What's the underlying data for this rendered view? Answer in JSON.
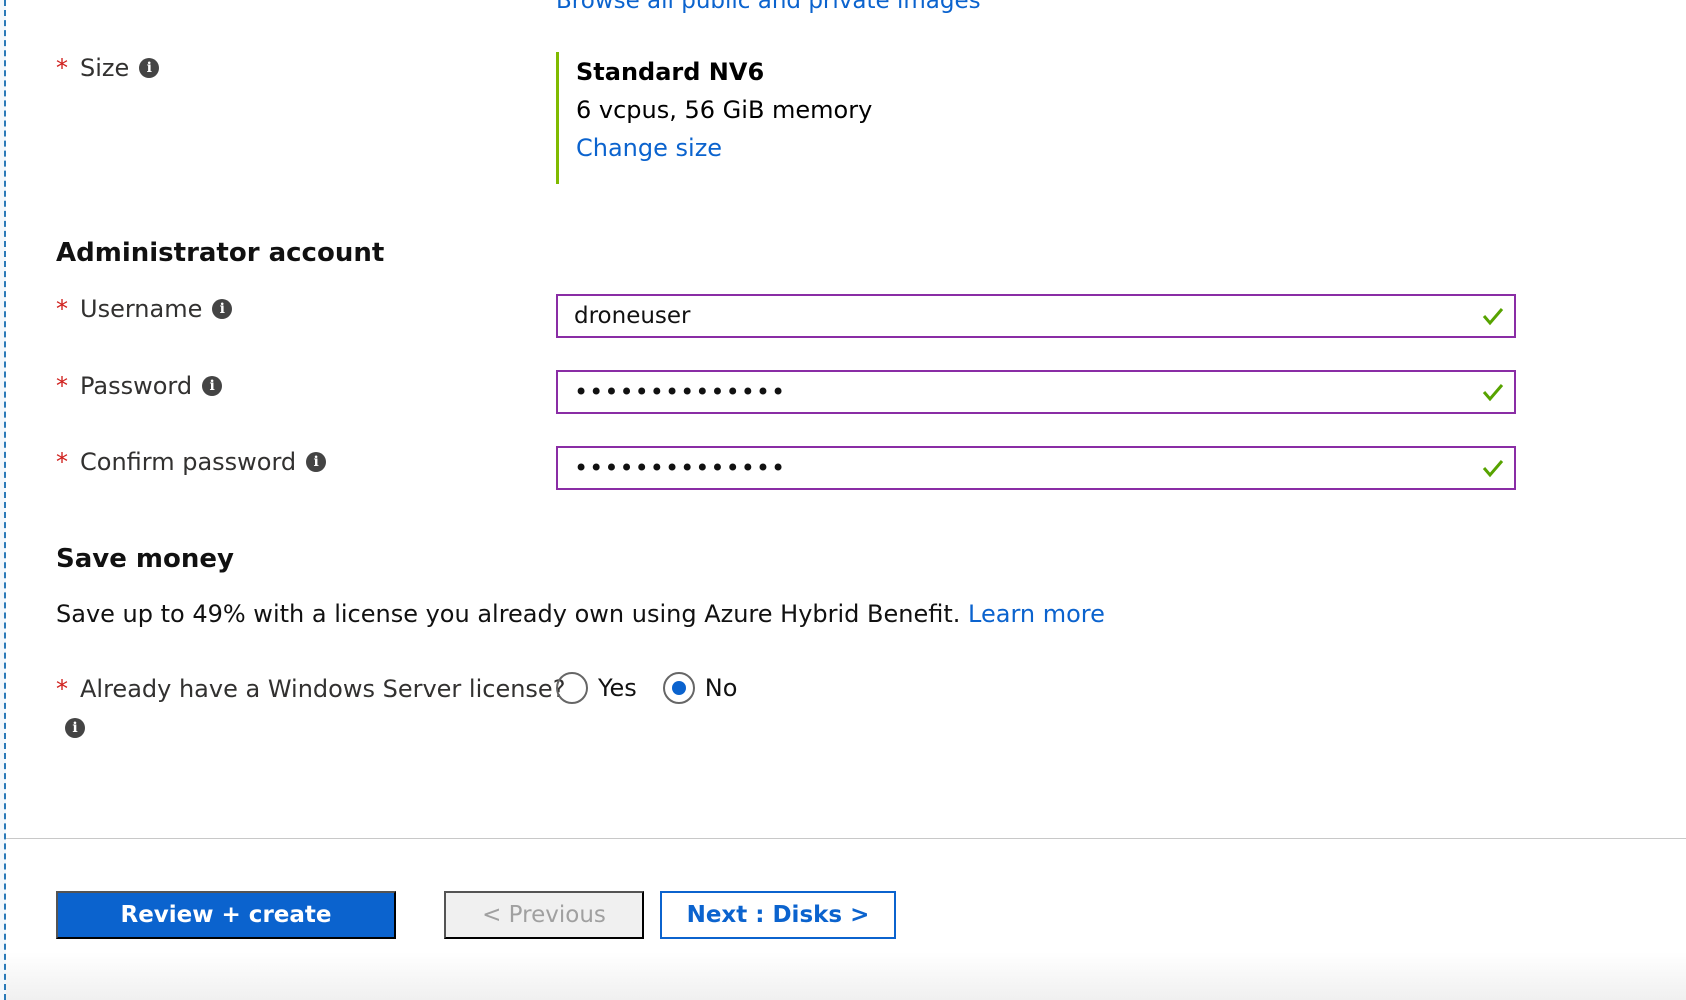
{
  "image": {
    "browse_link": "Browse all public and private images"
  },
  "size": {
    "label": "Size",
    "name": "Standard NV6",
    "description": "6 vcpus, 56 GiB memory",
    "change_link": "Change size"
  },
  "admin": {
    "heading": "Administrator account",
    "username_label": "Username",
    "username_value": "droneuser",
    "password_label": "Password",
    "password_mask": "••••••••••••••",
    "confirm_label": "Confirm password",
    "confirm_mask": "••••••••••••••"
  },
  "save_money": {
    "heading": "Save money",
    "promo_text": "Save up to 49% with a license you already own using Azure Hybrid Benefit. ",
    "learn_more": "Learn more",
    "license_question": "Already have a Windows Server license?",
    "options": [
      "Yes",
      "No"
    ],
    "selected": "No"
  },
  "footer": {
    "review_create": "Review + create",
    "previous": "< Previous",
    "next": "Next : Disks >"
  },
  "icons": {
    "info": "info-icon",
    "valid": "check-icon"
  },
  "colors": {
    "accent": "#0b63ce",
    "required": "#d0201d",
    "input_border": "#8a2da5",
    "valid_check": "#57a300",
    "size_bar": "#7fba00"
  }
}
